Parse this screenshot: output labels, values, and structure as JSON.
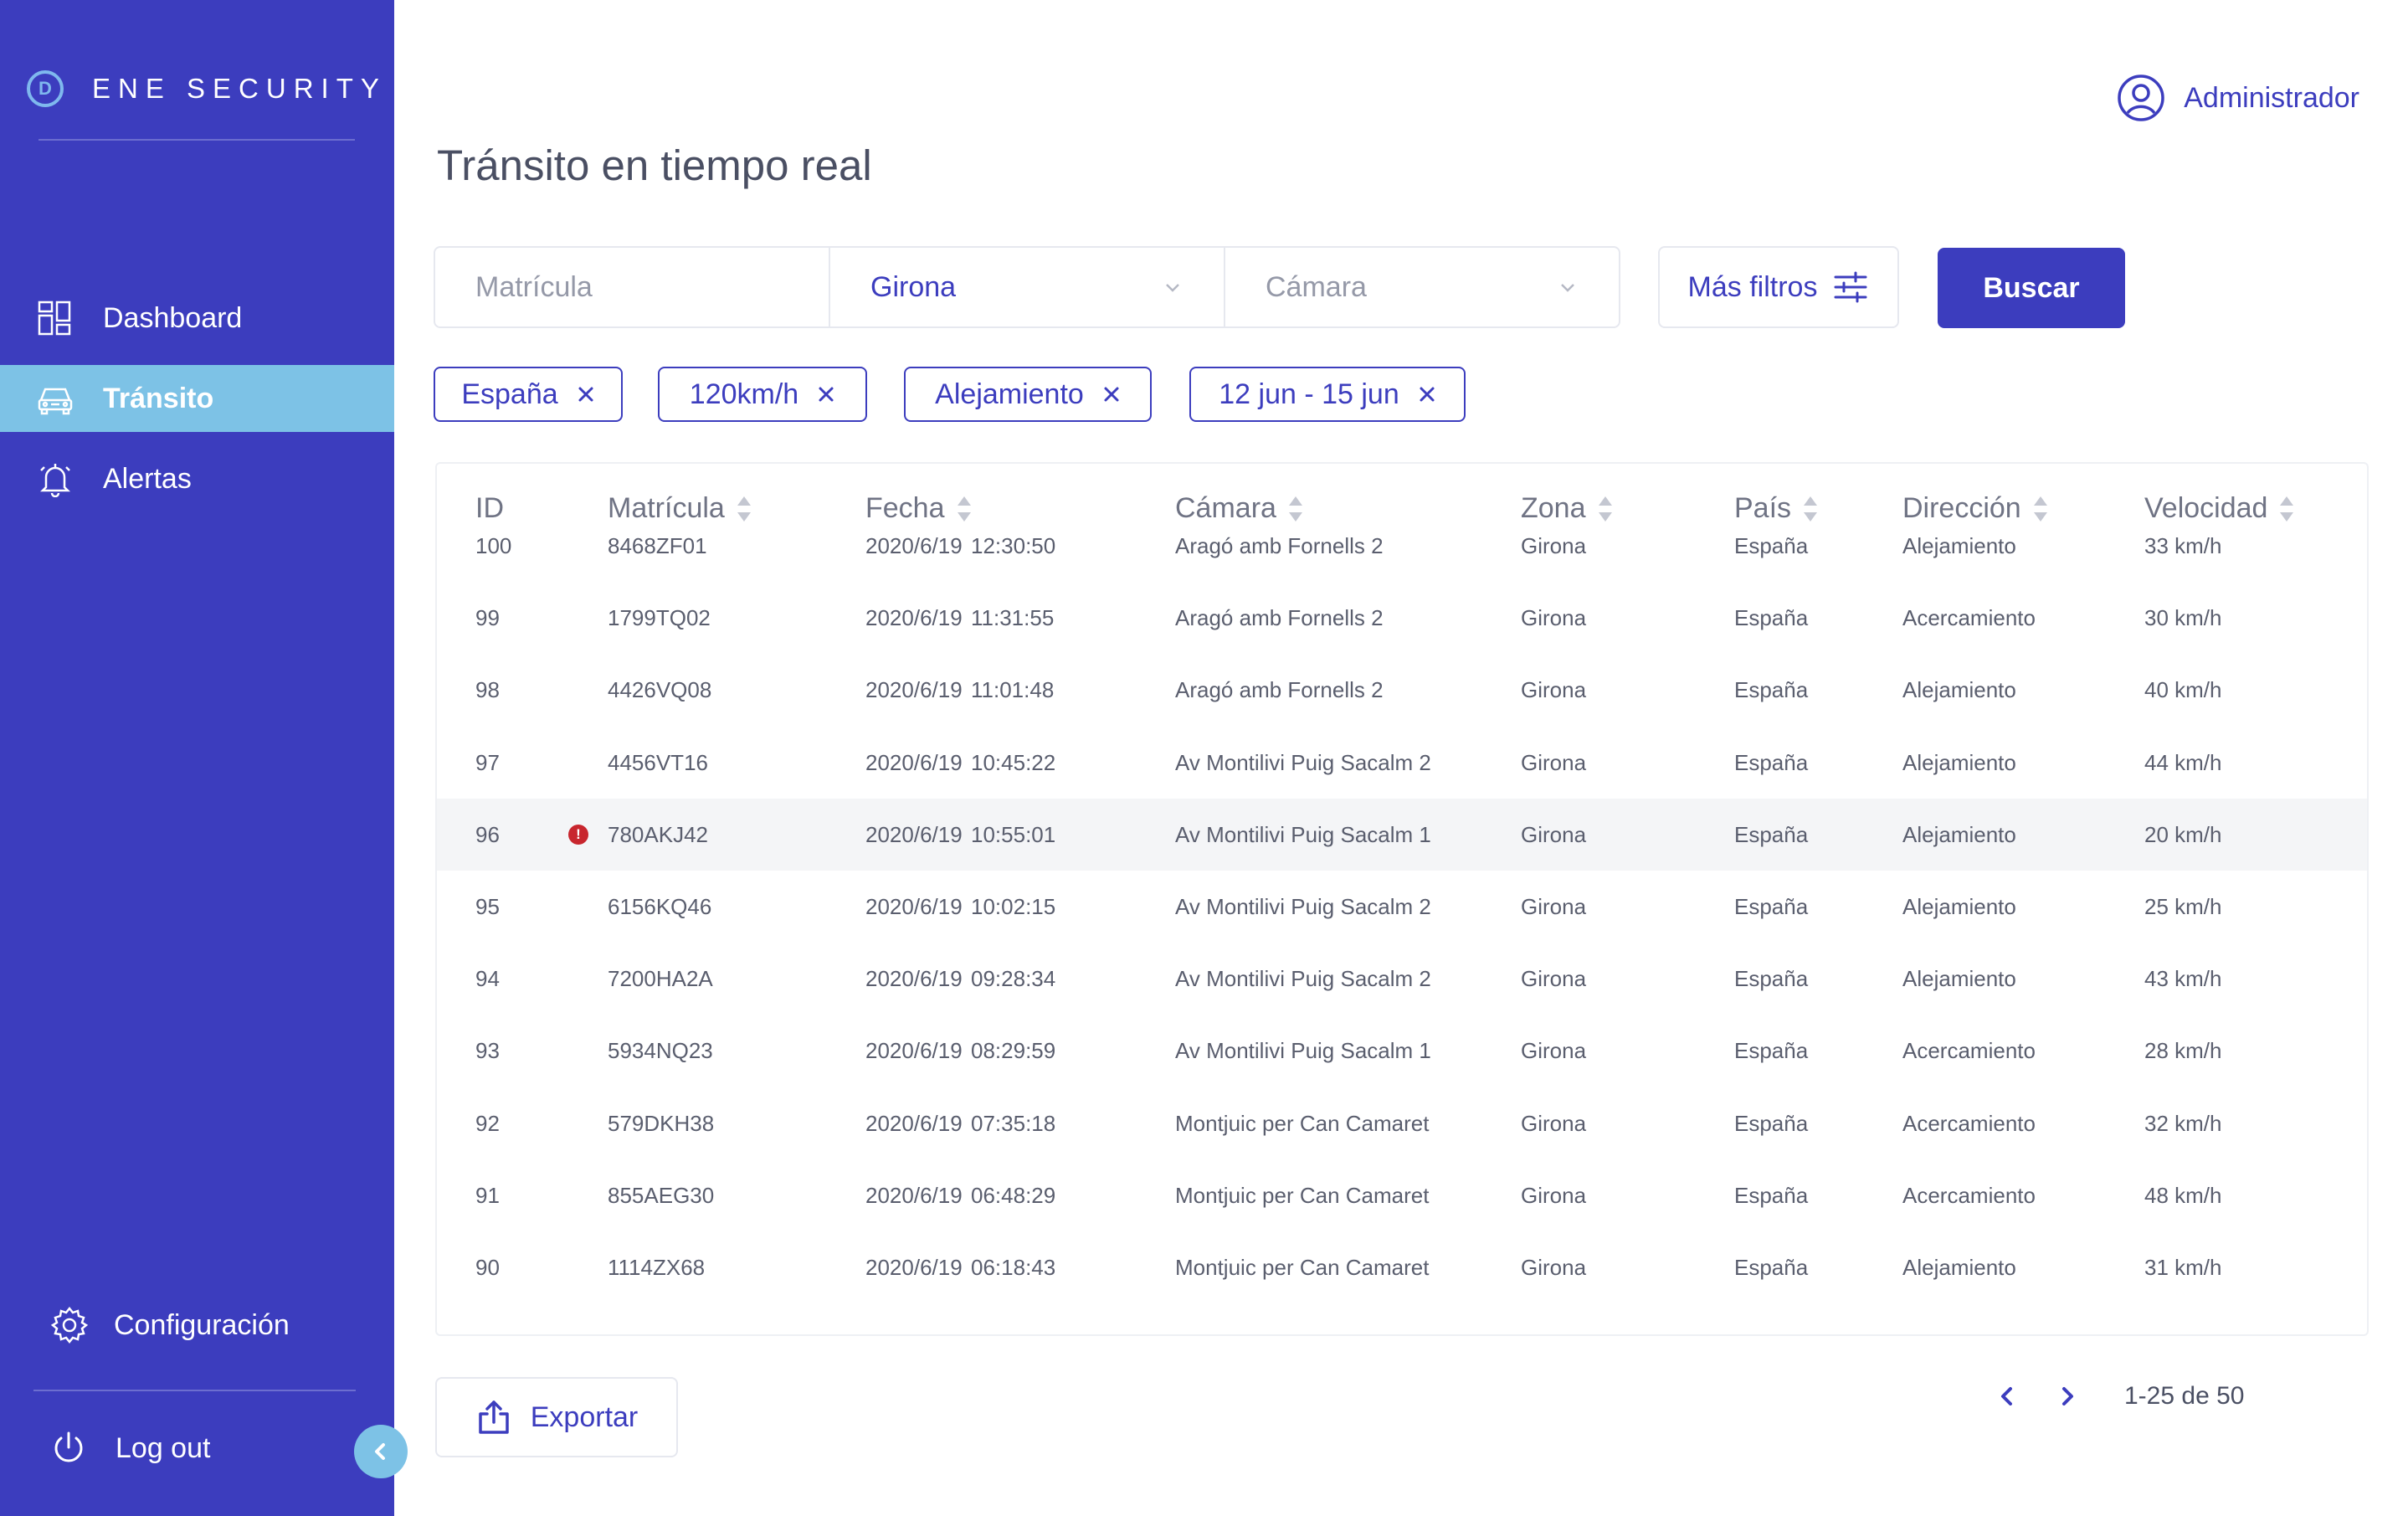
{
  "brand": {
    "name": "ENE SECURITY",
    "logo_letter": "D"
  },
  "sidebar": {
    "items": [
      {
        "label": "Dashboard",
        "icon": "dashboard-icon",
        "active": false
      },
      {
        "label": "Tránsito",
        "icon": "car-icon",
        "active": true
      },
      {
        "label": "Alertas",
        "icon": "bell-icon",
        "active": false
      }
    ],
    "config_label": "Configuración",
    "logout_label": "Log out"
  },
  "header": {
    "user_label": "Administrador",
    "page_title": "Tránsito en tiempo real"
  },
  "filters": {
    "plate_placeholder": "Matrícula",
    "zone_value": "Girona",
    "camera_placeholder": "Cámara",
    "more_filters_label": "Más filtros",
    "search_label": "Buscar"
  },
  "chips": [
    {
      "label": "España"
    },
    {
      "label": "120km/h"
    },
    {
      "label": "Alejamiento"
    },
    {
      "label": "12 jun - 15 jun"
    }
  ],
  "table": {
    "columns": [
      "ID",
      "Matrícula",
      "Fecha",
      "Cámara",
      "Zona",
      "País",
      "Dirección",
      "Velocidad"
    ],
    "rows": [
      {
        "id": "100",
        "plate": "8468ZF01",
        "date": "2020/6/19",
        "time": "12:30:50",
        "camera": "Aragó amb Fornells 2",
        "zone": "Girona",
        "country": "España",
        "direction": "Alejamiento",
        "speed": "33 km/h",
        "alert": false
      },
      {
        "id": "99",
        "plate": "1799TQ02",
        "date": "2020/6/19",
        "time": "11:31:55",
        "camera": "Aragó amb Fornells 2",
        "zone": "Girona",
        "country": "España",
        "direction": "Acercamiento",
        "speed": "30 km/h",
        "alert": false
      },
      {
        "id": "98",
        "plate": "4426VQ08",
        "date": "2020/6/19",
        "time": "11:01:48",
        "camera": "Aragó amb Fornells 2",
        "zone": "Girona",
        "country": "España",
        "direction": "Alejamiento",
        "speed": "40 km/h",
        "alert": false
      },
      {
        "id": "97",
        "plate": "4456VT16",
        "date": "2020/6/19",
        "time": "10:45:22",
        "camera": "Av Montilivi Puig Sacalm 2",
        "zone": "Girona",
        "country": "España",
        "direction": "Alejamiento",
        "speed": "44 km/h",
        "alert": false
      },
      {
        "id": "96",
        "plate": "780AKJ42",
        "date": "2020/6/19",
        "time": "10:55:01",
        "camera": "Av Montilivi Puig Sacalm 1",
        "zone": "Girona",
        "country": "España",
        "direction": "Alejamiento",
        "speed": "20 km/h",
        "alert": true
      },
      {
        "id": "95",
        "plate": "6156KQ46",
        "date": "2020/6/19",
        "time": "10:02:15",
        "camera": "Av Montilivi Puig Sacalm 2",
        "zone": "Girona",
        "country": "España",
        "direction": "Alejamiento",
        "speed": "25 km/h",
        "alert": false
      },
      {
        "id": "94",
        "plate": "7200HA2A",
        "date": "2020/6/19",
        "time": "09:28:34",
        "camera": "Av Montilivi Puig Sacalm 2",
        "zone": "Girona",
        "country": "España",
        "direction": "Alejamiento",
        "speed": "43 km/h",
        "alert": false
      },
      {
        "id": "93",
        "plate": "5934NQ23",
        "date": "2020/6/19",
        "time": "08:29:59",
        "camera": "Av Montilivi Puig Sacalm 1",
        "zone": "Girona",
        "country": "España",
        "direction": "Acercamiento",
        "speed": "28 km/h",
        "alert": false
      },
      {
        "id": "92",
        "plate": "579DKH38",
        "date": "2020/6/19",
        "time": "07:35:18",
        "camera": "Montjuic per Can Camaret",
        "zone": "Girona",
        "country": "España",
        "direction": "Acercamiento",
        "speed": "32 km/h",
        "alert": false
      },
      {
        "id": "91",
        "plate": "855AEG30",
        "date": "2020/6/19",
        "time": "06:48:29",
        "camera": "Montjuic per Can Camaret",
        "zone": "Girona",
        "country": "España",
        "direction": "Acercamiento",
        "speed": "48 km/h",
        "alert": false
      },
      {
        "id": "90",
        "plate": "1114ZX68",
        "date": "2020/6/19",
        "time": "06:18:43",
        "camera": "Montjuic per Can Camaret",
        "zone": "Girona",
        "country": "España",
        "direction": "Alejamiento",
        "speed": "31 km/h",
        "alert": false
      }
    ]
  },
  "footer": {
    "export_label": "Exportar",
    "pagination_text": "1-25 de 50"
  },
  "colors": {
    "sidebar": "#3c3dbe",
    "active_item": "#7dc2e6",
    "accent": "#3c3dbe",
    "alert": "#c8262e"
  }
}
